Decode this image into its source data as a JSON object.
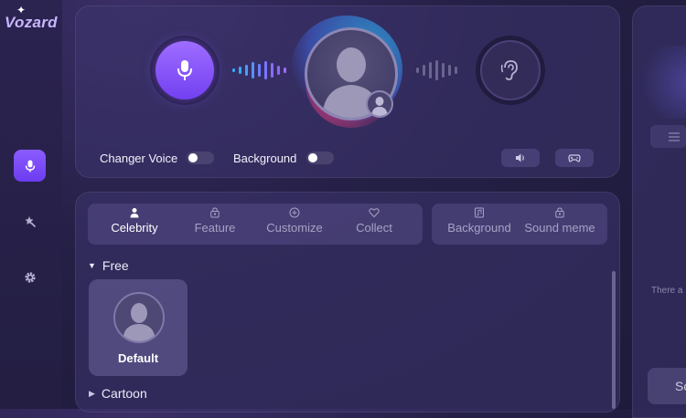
{
  "app": {
    "logo": "Vozard"
  },
  "controls": {
    "changer_voice_label": "Changer Voice",
    "background_label": "Background"
  },
  "tabs": [
    {
      "label": "Celebrity",
      "icon": "person-icon",
      "active": true
    },
    {
      "label": "Feature",
      "icon": "lock-icon",
      "active": false
    },
    {
      "label": "Customize",
      "icon": "plus-circle-icon",
      "active": false
    },
    {
      "label": "Collect",
      "icon": "heart-icon",
      "active": false
    },
    {
      "label": "Background",
      "icon": "music-note-icon",
      "active": false
    },
    {
      "label": "Sound meme",
      "icon": "lock-icon",
      "active": false
    }
  ],
  "sections": {
    "free_label": "Free",
    "cartoon_label": "Cartoon"
  },
  "voices": [
    {
      "label": "Default"
    }
  ],
  "right_panel": {
    "info_text": "There a",
    "button_text": "So"
  },
  "colors": {
    "accent": "#7c4dff",
    "wave_blue": "#3aa8ff",
    "wave_purple": "#9b6dff"
  }
}
